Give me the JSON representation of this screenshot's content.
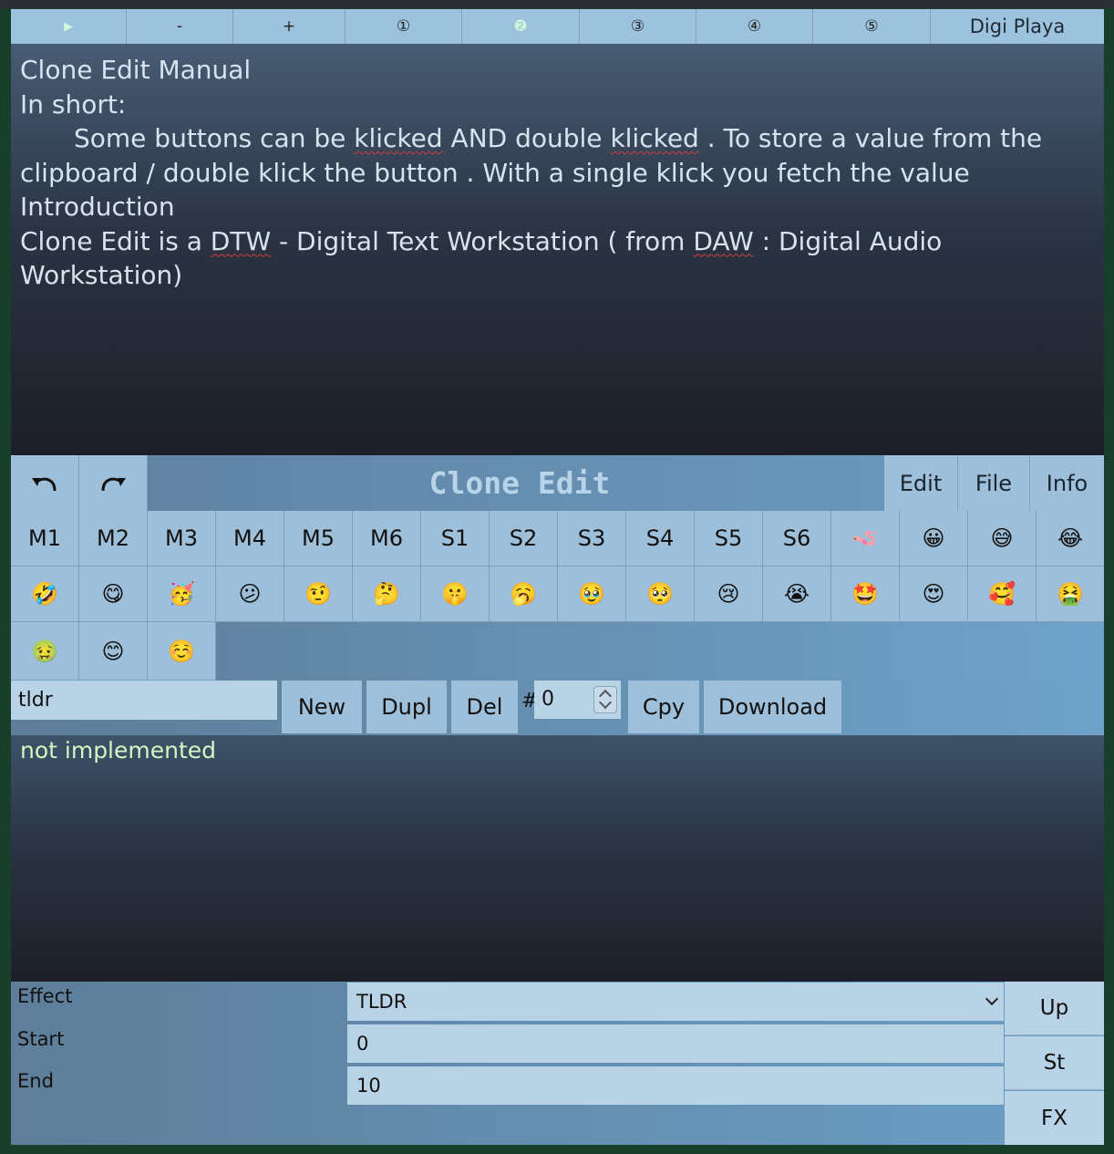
{
  "topbar": {
    "buttons": [
      "▶",
      "-",
      "+",
      "①",
      "❷",
      "③",
      "④",
      "⑤"
    ],
    "title": "Digi Playa"
  },
  "manual": {
    "title": "Clone Edit Manual",
    "line_short": "In short:",
    "para1": [
      "Some buttons can be ",
      "klicked",
      " AND double ",
      "klicked",
      " . To store a value from the clipboard / double klick the button . With a single klick you fetch the value"
    ],
    "intro_heading": "Introduction",
    "para2": [
      "Clone Edit is a ",
      "DTW",
      " - Digital Text Workstation ( from ",
      "DAW",
      " : Digital Audio Workstation)"
    ]
  },
  "header": {
    "undo_icon": "undo-icon",
    "redo_icon": "redo-icon",
    "title": "Clone Edit",
    "menu": [
      "Edit",
      "File",
      "Info"
    ]
  },
  "grid": {
    "items": [
      "M1",
      "M2",
      "M3",
      "M4",
      "M5",
      "M6",
      "S1",
      "S2",
      "S3",
      "S4",
      "S5",
      "S6",
      "🪱",
      "😀",
      "😅",
      "😂",
      "🤣",
      "😋",
      "🥳",
      "😕",
      "🤨",
      "🤔",
      "🤫",
      "🥱",
      "🥹",
      "🥺",
      "😢",
      "😭",
      "🤩",
      "😍",
      "🥰",
      "🤮",
      "🤢",
      "😊",
      "☺️"
    ]
  },
  "controls": {
    "name_value": "tldr",
    "new_label": "New",
    "dupl_label": "Dupl",
    "del_label": "Del",
    "hash": "#",
    "number_value": "0",
    "cpy_label": "Cpy",
    "download_label": "Download"
  },
  "output": {
    "text": "not implemented"
  },
  "form": {
    "effect_label": "Effect",
    "effect_value": "TLDR",
    "start_label": "Start",
    "start_value": "0",
    "end_label": "End",
    "end_value": "10",
    "up_label": "Up",
    "st_label": "St",
    "fx_label": "FX"
  },
  "colors": {
    "background": "#173f2c",
    "button": "#9dbfd9",
    "field": "#b8d3e6",
    "output_text": "#d3f7c2"
  }
}
